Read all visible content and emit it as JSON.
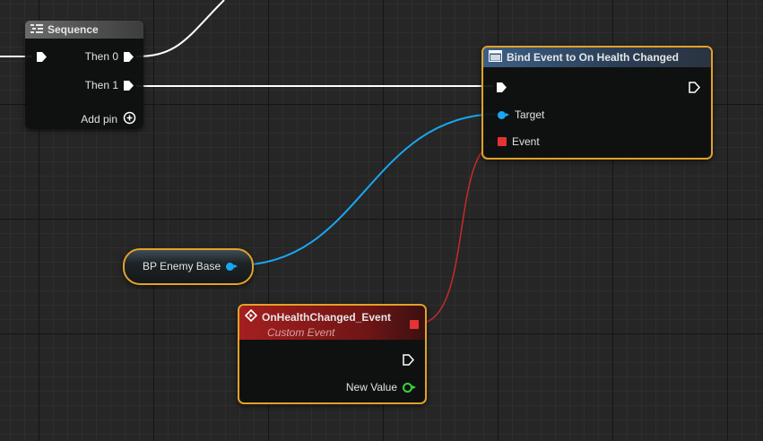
{
  "graph": {
    "sequence": {
      "title": "Sequence",
      "then0": "Then 0",
      "then1": "Then 1",
      "add_pin": "Add pin"
    },
    "bind_event": {
      "title": "Bind Event to On Health Changed",
      "target": "Target",
      "event": "Event"
    },
    "variable": {
      "label": "BP Enemy Base"
    },
    "custom_event": {
      "title": "OnHealthChanged_Event",
      "subtitle": "Custom Event",
      "new_value": "New Value"
    }
  },
  "colors": {
    "selection_outline": "#e3a227",
    "exec_wire": "#ffffff",
    "object_wire": "#19a7f3",
    "delegate_wire": "#e53333",
    "bool_pin": "#37d637",
    "custom_event_header": "#8f1a1a",
    "function_header": "#2d4a6b",
    "sequence_header": "#5a5a5a"
  }
}
